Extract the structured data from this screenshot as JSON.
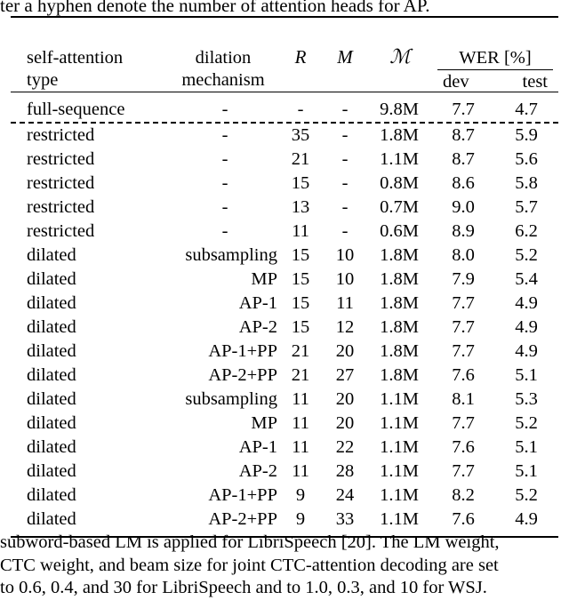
{
  "caption_tail": "ter a hyphen denote the number of attention heads for AP.",
  "table": {
    "header": {
      "col1_line1": "self-attention",
      "col1_line2": "type",
      "col2_line1": "dilation",
      "col2_line2": "mechanism",
      "col3": "R",
      "col4": "M",
      "col5": "ℳ",
      "wer_group": "WER [%]",
      "wer_dev": "dev",
      "wer_test": "test"
    },
    "rows": [
      {
        "type": "full-sequence",
        "mechanism": "-",
        "mechanism_centered": true,
        "R": "-",
        "M": "-",
        "Mcal": "9.8M",
        "dev": "7.7",
        "test": "4.7",
        "dev_bold": true,
        "test_bold": true
      },
      {
        "type": "restricted",
        "mechanism": "-",
        "mechanism_centered": true,
        "R": "35",
        "M": "-",
        "Mcal": "1.8M",
        "dev": "8.7",
        "test": "5.9",
        "dev_bold": false,
        "test_bold": false
      },
      {
        "type": "restricted",
        "mechanism": "-",
        "mechanism_centered": true,
        "R": "21",
        "M": "-",
        "Mcal": "1.1M",
        "dev": "8.7",
        "test": "5.6",
        "dev_bold": false,
        "test_bold": false
      },
      {
        "type": "restricted",
        "mechanism": "-",
        "mechanism_centered": true,
        "R": "15",
        "M": "-",
        "Mcal": "0.8M",
        "dev": "8.6",
        "test": "5.8",
        "dev_bold": false,
        "test_bold": false
      },
      {
        "type": "restricted",
        "mechanism": "-",
        "mechanism_centered": true,
        "R": "13",
        "M": "-",
        "Mcal": "0.7M",
        "dev": "9.0",
        "test": "5.7",
        "dev_bold": false,
        "test_bold": false
      },
      {
        "type": "restricted",
        "mechanism": "-",
        "mechanism_centered": true,
        "R": "11",
        "M": "-",
        "Mcal": "0.6M",
        "dev": "8.9",
        "test": "6.2",
        "dev_bold": false,
        "test_bold": false
      },
      {
        "type": "dilated",
        "mechanism": "subsampling",
        "mechanism_centered": false,
        "R": "15",
        "M": "10",
        "Mcal": "1.8M",
        "dev": "8.0",
        "test": "5.2",
        "dev_bold": false,
        "test_bold": false
      },
      {
        "type": "dilated",
        "mechanism": "MP",
        "mechanism_centered": false,
        "R": "15",
        "M": "10",
        "Mcal": "1.8M",
        "dev": "7.9",
        "test": "5.4",
        "dev_bold": false,
        "test_bold": false
      },
      {
        "type": "dilated",
        "mechanism": "AP-1",
        "mechanism_centered": false,
        "R": "15",
        "M": "11",
        "Mcal": "1.8M",
        "dev": "7.7",
        "test": "4.9",
        "dev_bold": false,
        "test_bold": false
      },
      {
        "type": "dilated",
        "mechanism": "AP-2",
        "mechanism_centered": false,
        "R": "15",
        "M": "12",
        "Mcal": "1.8M",
        "dev": "7.7",
        "test": "4.9",
        "dev_bold": false,
        "test_bold": false
      },
      {
        "type": "dilated",
        "mechanism": "AP-1+PP",
        "mechanism_centered": false,
        "R": "21",
        "M": "20",
        "Mcal": "1.8M",
        "dev": "7.7",
        "test": "4.9",
        "dev_bold": false,
        "test_bold": false
      },
      {
        "type": "dilated",
        "mechanism": "AP-2+PP",
        "mechanism_centered": false,
        "R": "21",
        "M": "27",
        "Mcal": "1.8M",
        "dev": "7.6",
        "test": "5.1",
        "dev_bold": false,
        "test_bold": false
      },
      {
        "type": "dilated",
        "mechanism": "subsampling",
        "mechanism_centered": false,
        "R": "11",
        "M": "20",
        "Mcal": "1.1M",
        "dev": "8.1",
        "test": "5.3",
        "dev_bold": false,
        "test_bold": false
      },
      {
        "type": "dilated",
        "mechanism": "MP",
        "mechanism_centered": false,
        "R": "11",
        "M": "20",
        "Mcal": "1.1M",
        "dev": "7.7",
        "test": "5.2",
        "dev_bold": false,
        "test_bold": false
      },
      {
        "type": "dilated",
        "mechanism": "AP-1",
        "mechanism_centered": false,
        "R": "11",
        "M": "22",
        "Mcal": "1.1M",
        "dev": "7.6",
        "test": "5.1",
        "dev_bold": false,
        "test_bold": false
      },
      {
        "type": "dilated",
        "mechanism": "AP-2",
        "mechanism_centered": false,
        "R": "11",
        "M": "28",
        "Mcal": "1.1M",
        "dev": "7.7",
        "test": "5.1",
        "dev_bold": false,
        "test_bold": false
      },
      {
        "type": "dilated",
        "mechanism": "AP-1+PP",
        "mechanism_centered": false,
        "R": "9",
        "M": "24",
        "Mcal": "1.1M",
        "dev": "8.2",
        "test": "5.2",
        "dev_bold": false,
        "test_bold": false
      },
      {
        "type": "dilated",
        "mechanism": "AP-2+PP",
        "mechanism_centered": false,
        "R": "9",
        "M": "33",
        "Mcal": "1.1M",
        "dev": "7.6",
        "test": "4.9",
        "dev_bold": true,
        "test_bold": true
      }
    ]
  },
  "body_text": {
    "line1": "subword-based LM is applied for LibriSpeech [20]. The LM weight,",
    "line2": "CTC weight, and beam size for joint CTC-attention decoding are set",
    "line3": "to 0.6, 0.4, and 30 for LibriSpeech and to 1.0, 0.3, and 10 for WSJ."
  }
}
